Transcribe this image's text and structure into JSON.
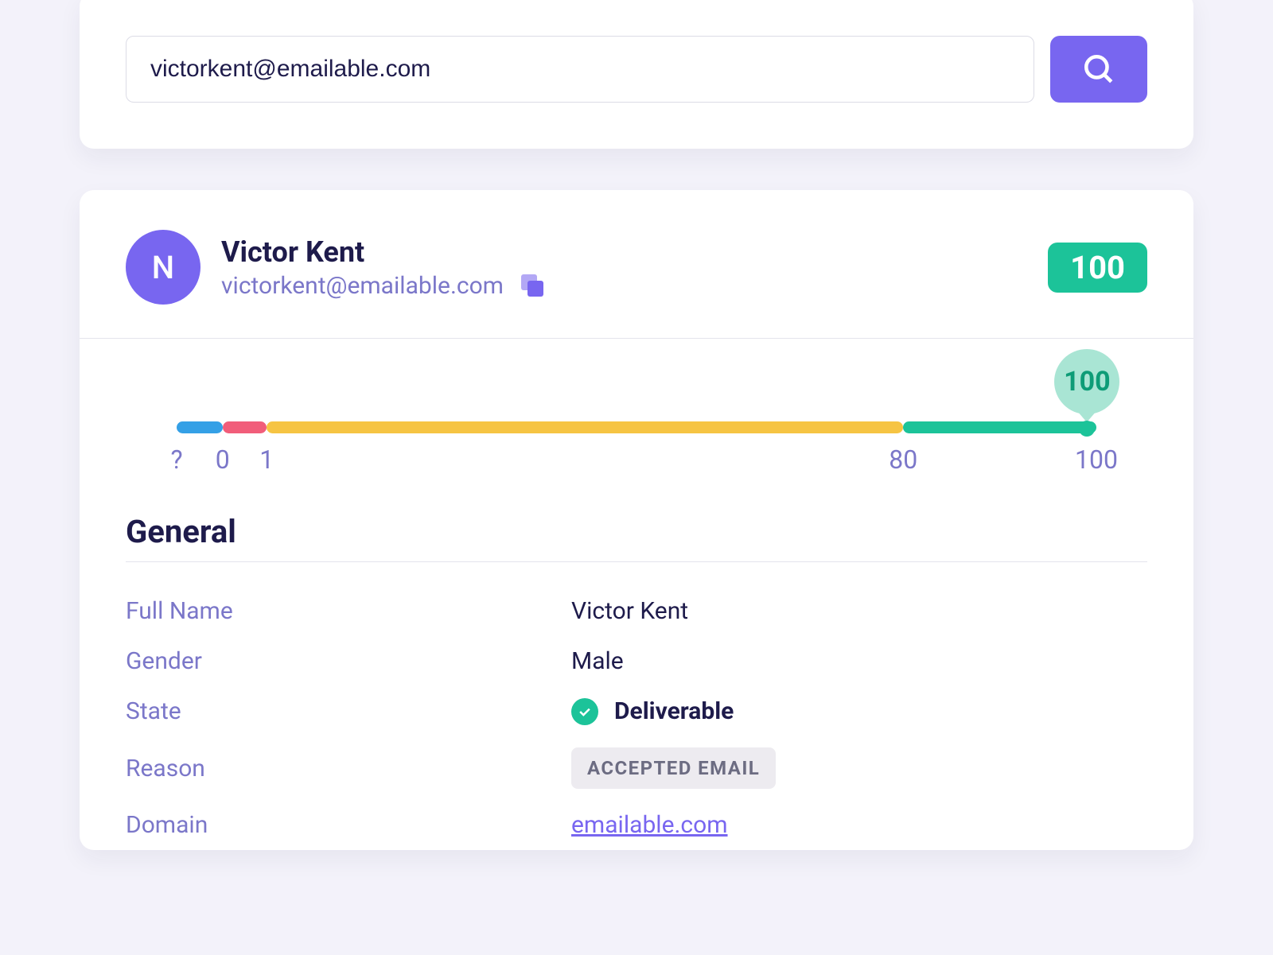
{
  "search": {
    "value": "victorkent@emailable.com"
  },
  "result": {
    "avatar_initial": "N",
    "name": "Victor Kent",
    "email": "victorkent@emailable.com",
    "score": "100"
  },
  "scale": {
    "bubble_value": "100",
    "segments": {
      "blue": {
        "left_pct": 0.0,
        "width_pct": 5.0
      },
      "pink": {
        "left_pct": 5.0,
        "width_pct": 4.8
      },
      "yellow": {
        "left_pct": 9.8,
        "width_pct": 69.2
      },
      "green": {
        "left_pct": 79.0,
        "width_pct": 21.0
      }
    },
    "marker_pct": 99.0,
    "ticks": [
      {
        "label": "?",
        "pct": 0.0
      },
      {
        "label": "0",
        "pct": 5.0
      },
      {
        "label": "1",
        "pct": 9.8
      },
      {
        "label": "80",
        "pct": 79.0
      },
      {
        "label": "100",
        "pct": 100.0
      }
    ]
  },
  "section_title": "General",
  "fields": {
    "full_name": {
      "label": "Full Name",
      "value": "Victor Kent"
    },
    "gender": {
      "label": "Gender",
      "value": "Male"
    },
    "state": {
      "label": "State",
      "value": "Deliverable"
    },
    "reason": {
      "label": "Reason",
      "value": "ACCEPTED EMAIL"
    },
    "domain": {
      "label": "Domain",
      "value": "emailable.com"
    }
  },
  "colors": {
    "purple": "#7866F0",
    "green": "#1CC399",
    "blue": "#34A0E6",
    "pink": "#F15D7A",
    "yellow": "#F6C443"
  }
}
